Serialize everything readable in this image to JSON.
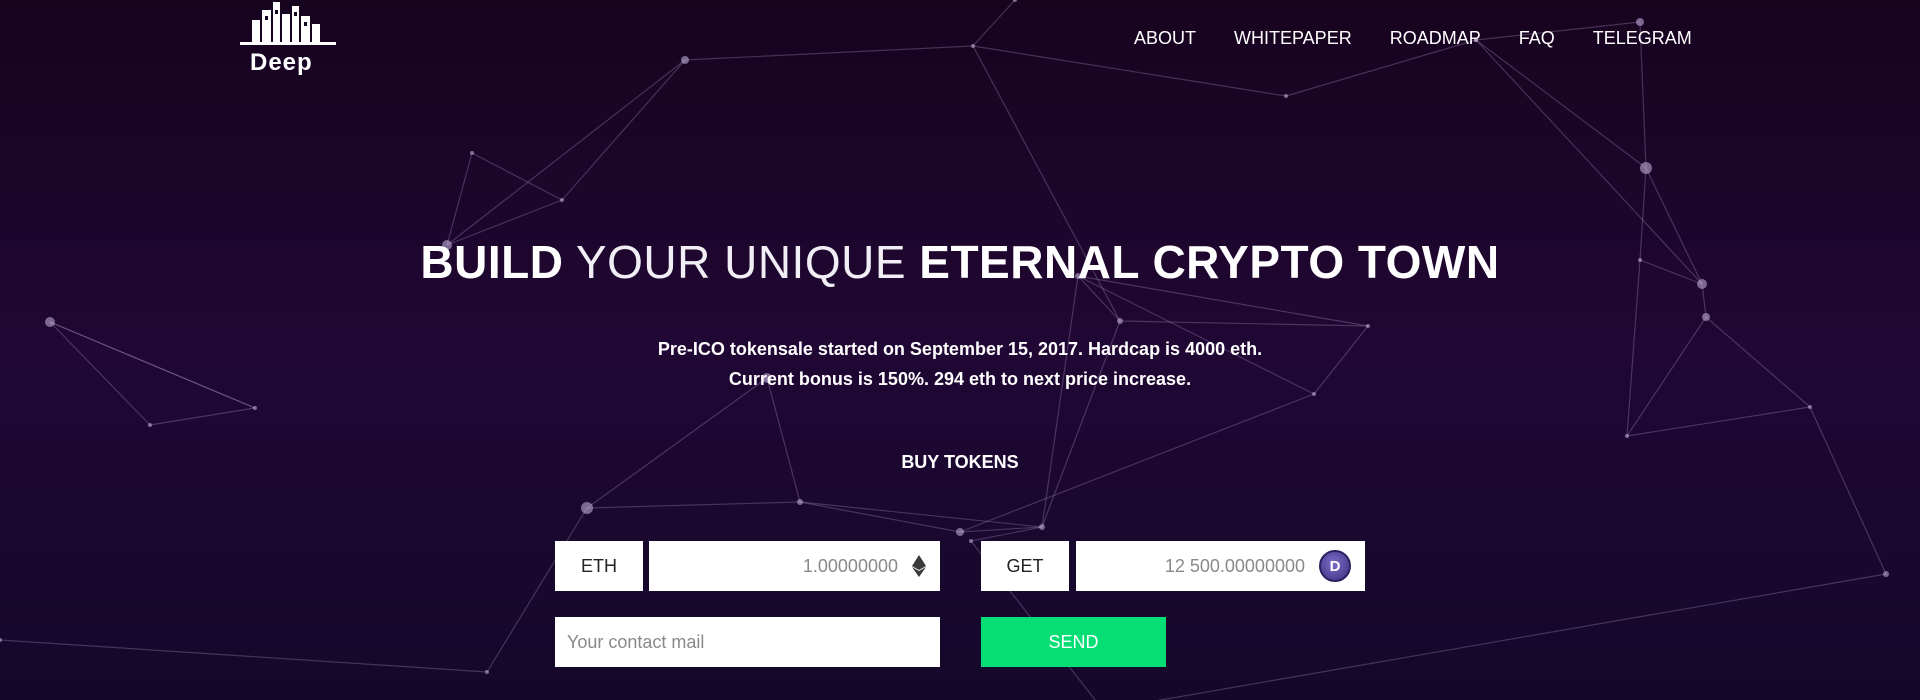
{
  "brand": {
    "logo_text": "Deep"
  },
  "nav": {
    "items": [
      "ABOUT",
      "WHITEPAPER",
      "ROADMAP",
      "FAQ",
      "TELEGRAM"
    ]
  },
  "hero": {
    "headline_part1": "BUILD",
    "headline_part2": " YOUR UNIQUE ",
    "headline_part3": "ETERNAL CRYPTO TOWN",
    "line1": "Pre-ICO tokensale started on September 15, 2017. Hardcap is 4000 eth.",
    "line2": "Current bonus is 150%. 294 eth to next price increase."
  },
  "purchase": {
    "title": "BUY TOKENS",
    "pay_currency": "ETH",
    "pay_amount": "1.00000000",
    "get_label": "GET",
    "get_amount": "12 500.00000000",
    "email_placeholder": "Your contact mail",
    "send_label": "SEND"
  },
  "colors": {
    "background_top": "#17041f",
    "background_mid": "#200734",
    "accent_send": "#04de74"
  },
  "icons": {
    "eth": "ethereum-icon",
    "token": "deep-coin-icon"
  }
}
